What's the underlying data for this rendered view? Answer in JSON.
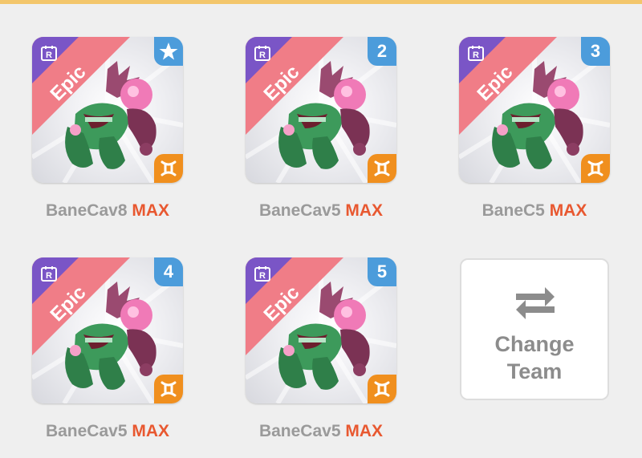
{
  "team": [
    {
      "rarity": "Epic",
      "badge_icon": "star-icon",
      "slot_number": "",
      "name": "BaneCav8",
      "level_tag": "MAX",
      "class_icon": "orange-class-icon"
    },
    {
      "rarity": "Epic",
      "badge_icon": "",
      "slot_number": "2",
      "name": "BaneCav5",
      "level_tag": "MAX",
      "class_icon": "orange-class-icon"
    },
    {
      "rarity": "Epic",
      "badge_icon": "",
      "slot_number": "3",
      "name": "BaneC5",
      "level_tag": "MAX",
      "class_icon": "orange-class-icon"
    },
    {
      "rarity": "Epic",
      "badge_icon": "",
      "slot_number": "4",
      "name": "BaneCav5",
      "level_tag": "MAX",
      "class_icon": "orange-class-icon"
    },
    {
      "rarity": "Epic",
      "badge_icon": "",
      "slot_number": "5",
      "name": "BaneCav5",
      "level_tag": "MAX",
      "class_icon": "orange-class-icon"
    }
  ],
  "change_team": {
    "line1": "Change",
    "line2": "Team",
    "icon": "swap-arrows-icon"
  },
  "colors": {
    "rarity_ribbon": "#f07d87",
    "rarity_corner": "#7a55c6",
    "slot_badge": "#4c9cdb",
    "class_badge": "#f08f1e",
    "max_text": "#e85830",
    "name_text": "#9a9a9a",
    "top_rule": "#f3c66b"
  }
}
